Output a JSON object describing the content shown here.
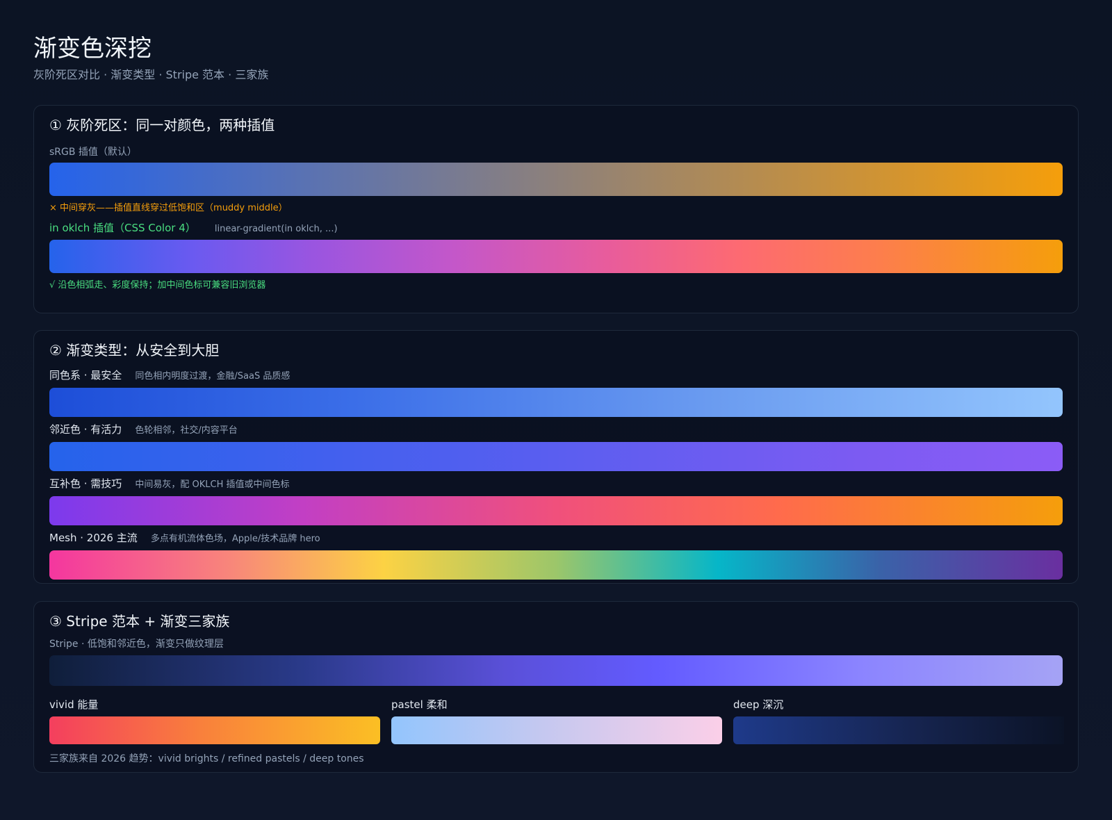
{
  "header": {
    "title": "渐变色深挖",
    "subtitle": "灰阶死区对比 · 渐变类型 · Stripe 范本 · 三家族"
  },
  "card1": {
    "title": "① 灰阶死区：同一对颜色，两种插值",
    "srgb_label": "sRGB 插值（默认）",
    "srgb_warning": "× 中间穿灰——插值直线穿过低饱和区（muddy middle）",
    "oklch_label": "in oklch 插值（CSS Color 4）",
    "oklch_code": "linear-gradient(in oklch, ...)",
    "oklch_ok": "√ 沿色相弧走、彩度保持；加中间色标可兼容旧浏览器",
    "colors": {
      "from": "#2563eb",
      "to": "#f59e0b",
      "warn": "#f59e0b",
      "ok": "#4ade80"
    }
  },
  "card2": {
    "title": "② 渐变类型：从安全到大胆",
    "types": [
      {
        "name": "同色系 · 最安全",
        "desc": "同色相内明度过渡，金融/SaaS 品质感"
      },
      {
        "name": "邻近色 · 有活力",
        "desc": "色轮相邻，社交/内容平台"
      },
      {
        "name": "互补色 · 需技巧",
        "desc": "中间易灰，配 OKLCH 插值或中间色标"
      },
      {
        "name": "Mesh · 2026 主流",
        "desc": "多点有机流体色场，Apple/技术品牌 hero"
      }
    ]
  },
  "card3": {
    "title": "③ Stripe 范本 + 渐变三家族",
    "stripe_label": "Stripe · 低饱和邻近色，渐变只做纹理层",
    "families": [
      {
        "label": "vivid 能量"
      },
      {
        "label": "pastel 柔和"
      },
      {
        "label": "deep 深沉"
      }
    ],
    "footnote": "三家族来自 2026 趋势：vivid brights / refined pastels / deep tones"
  }
}
